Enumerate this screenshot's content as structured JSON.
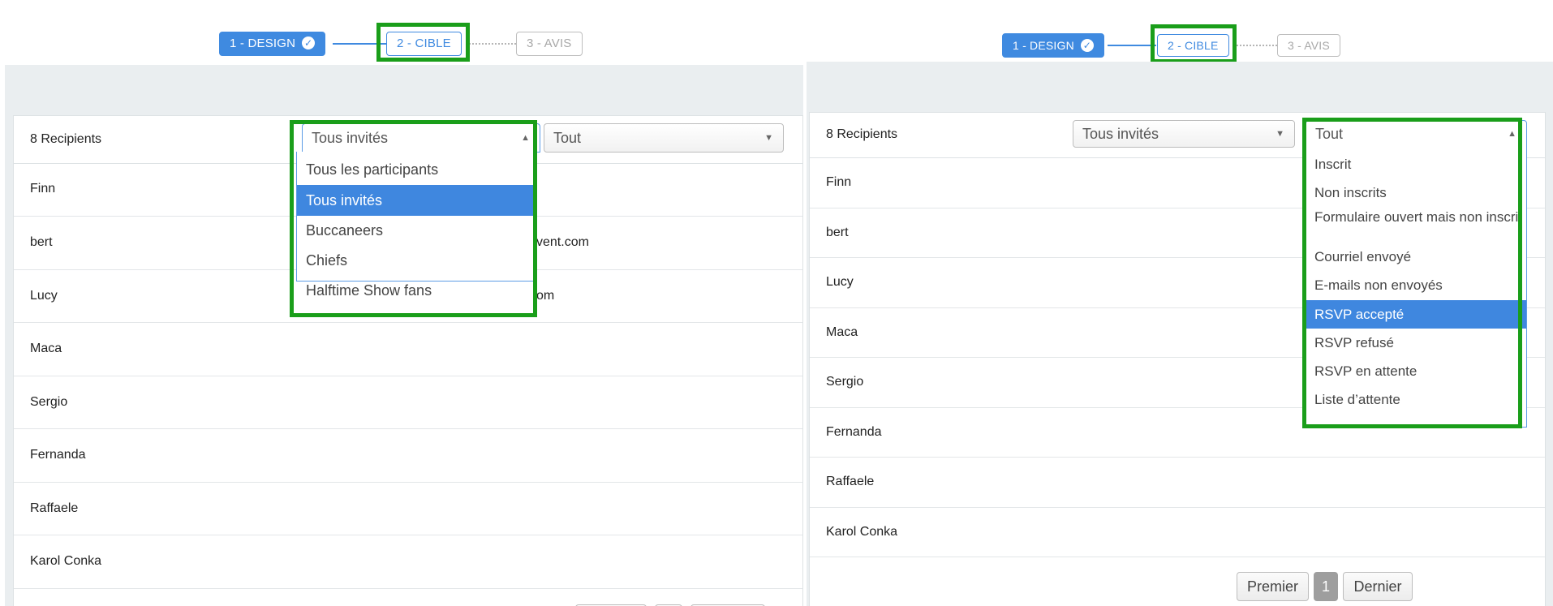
{
  "steps": {
    "design": "1 - DESIGN",
    "cible": "2 - CIBLE",
    "avis": "3 - AVIS"
  },
  "left": {
    "recipients_label": "8 Recipients",
    "group_select_value": "Tous invités",
    "status_select_value": "Tout",
    "group_options": [
      "Tous les participants",
      "Tous invités",
      "Buccaneers",
      "Chiefs",
      "Halftime Show fans"
    ],
    "selected_option": "Tous invités",
    "rows": [
      {
        "name": "Finn",
        "email": ""
      },
      {
        "name": "bert",
        "email": "vent.com"
      },
      {
        "name": "Lucy",
        "email": "om"
      },
      {
        "name": "Maca",
        "email": ""
      },
      {
        "name": "Sergio",
        "email": ""
      },
      {
        "name": "Fernanda",
        "email": ""
      },
      {
        "name": "Raffaele",
        "email": ""
      },
      {
        "name": "Karol Conka",
        "email": ""
      }
    ]
  },
  "right": {
    "recipients_label": "8 Recipients",
    "group_select_value": "Tous invités",
    "status_select_value": "Tout",
    "status_options": [
      "Inscrit",
      "Non inscrits",
      "Formulaire ouvert mais non inscrit",
      "Courriel envoyé",
      "E-mails non envoyés",
      "RSVP accepté",
      "RSVP refusé",
      "RSVP en attente",
      "Liste d’attente"
    ],
    "selected_option": "RSVP accepté",
    "rows": [
      {
        "name": "Finn"
      },
      {
        "name": "bert"
      },
      {
        "name": "Lucy"
      },
      {
        "name": "Maca"
      },
      {
        "name": "Sergio"
      },
      {
        "name": "Fernanda"
      },
      {
        "name": "Raffaele"
      },
      {
        "name": "Karol Conka"
      }
    ],
    "pager": {
      "first": "Premier",
      "page": "1",
      "last": "Dernier"
    }
  },
  "icons": {
    "step_done": "check-circle-icon",
    "select_arrow_down": "caret-down-icon",
    "select_arrow_up": "caret-up-icon"
  },
  "colors": {
    "accent": "#3f8ae0",
    "highlight_box": "#1a9e1a",
    "background": "#eaeef0"
  }
}
